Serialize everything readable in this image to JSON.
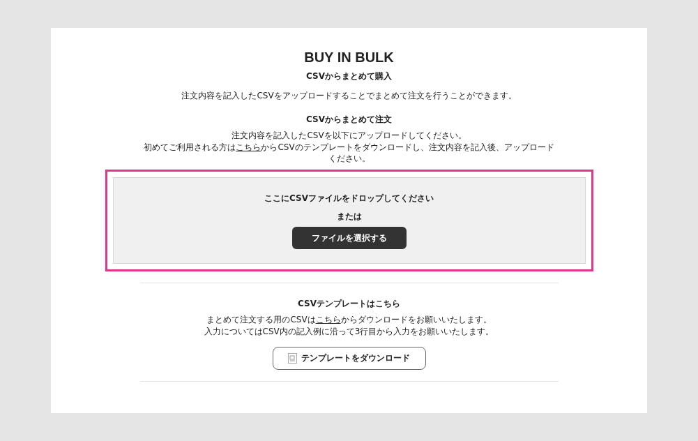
{
  "page": {
    "title": "BUY IN BULK",
    "subtitle": "CSVからまとめて購入",
    "description": "注文内容を記入したCSVをアップロードすることでまとめて注文を行うことができます。"
  },
  "upload_section": {
    "heading": "CSVからまとめて注文",
    "lines": [
      {
        "before": "注文内容を記入したCSVを以下にアップロードしてください。"
      },
      {
        "before": "初めてご利用される方は",
        "link": "こちら",
        "after": "からCSVのテンプレートをダウンロードし、注文内容を記入後、アップロードください。"
      }
    ],
    "dropzone": {
      "highlighted": true,
      "prompt": "ここにCSVファイルをドロップしてください",
      "or_text": "または",
      "button": "ファイルを選択する"
    }
  },
  "template_section": {
    "heading": "CSVテンプレートはこちら",
    "lines": [
      {
        "before": "まとめて注文する用のCSVは",
        "link": "こちら",
        "after": "からダウンロードをお願いいたします。"
      },
      {
        "before": "入力についてはCSV内の記入例に沿って3行目から入力をお願いいたします。"
      }
    ],
    "button": "テンプレートをダウンロード"
  }
}
